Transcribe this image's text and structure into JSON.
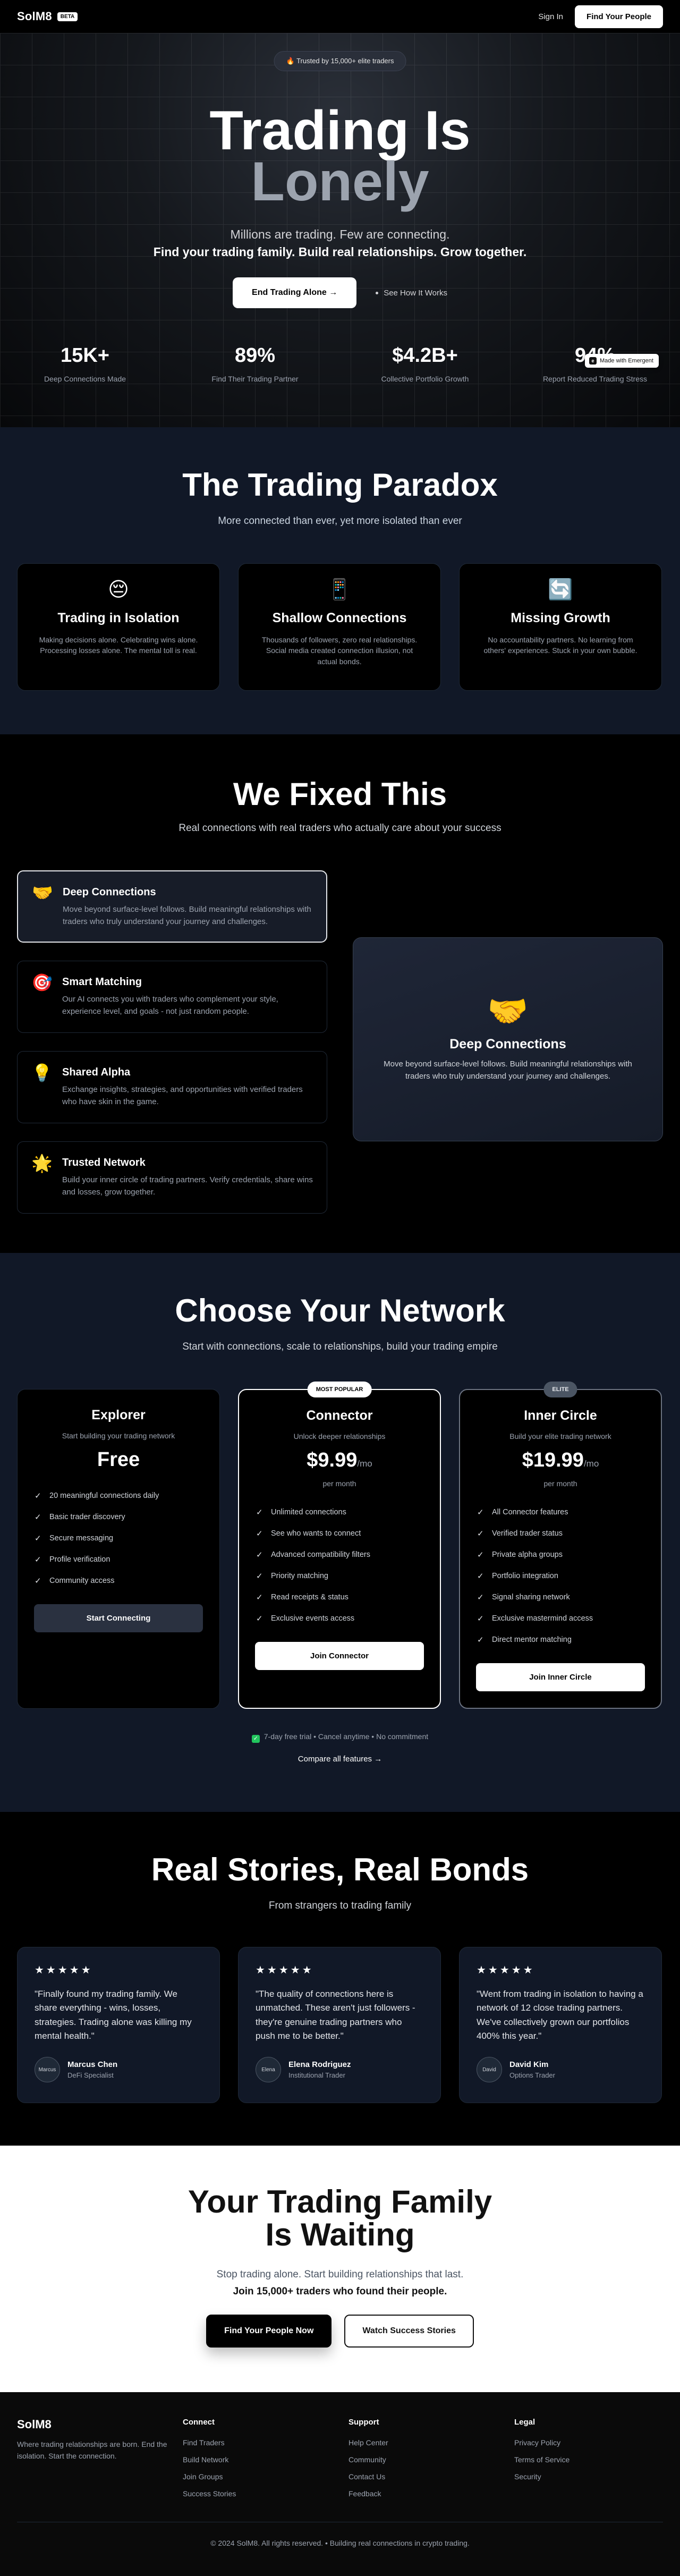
{
  "nav": {
    "brand": "SolM8",
    "badge": "BETA",
    "signin": "Sign In",
    "cta": "Find Your People"
  },
  "hero": {
    "trusted": "🔥 Trusted by 15,000+ elite traders",
    "title_line1": "Trading Is",
    "title_line2": "Lonely",
    "sub1": "Millions are trading. Few are connecting.",
    "sub2": "Find your trading family. Build real relationships. Grow together.",
    "cta": "End Trading Alone →",
    "secondary": "See How It Works",
    "stats": [
      {
        "value": "15K+",
        "label": "Deep Connections Made"
      },
      {
        "value": "89%",
        "label": "Find Their Trading Partner"
      },
      {
        "value": "$4.2B+",
        "label": "Collective Portfolio Growth"
      },
      {
        "value": "94%",
        "label": "Report Reduced Trading Stress"
      }
    ],
    "badge_emergent": "Made with Emergent"
  },
  "paradox": {
    "title": "The Trading Paradox",
    "subtitle": "More connected than ever, yet more isolated than ever",
    "cards": [
      {
        "emoji": "😔",
        "title": "Trading in Isolation",
        "text": "Making decisions alone. Celebrating wins alone. Processing losses alone. The mental toll is real."
      },
      {
        "emoji": "📱",
        "title": "Shallow Connections",
        "text": "Thousands of followers, zero real relationships. Social media created connection illusion, not actual bonds."
      },
      {
        "emoji": "🔄",
        "title": "Missing Growth",
        "text": "No accountability partners. No learning from others' experiences. Stuck in your own bubble."
      }
    ]
  },
  "fixed": {
    "title": "We Fixed This",
    "subtitle": "Real connections with real traders who actually care about your success",
    "items": [
      {
        "emoji": "🤝",
        "title": "Deep Connections",
        "text": "Move beyond surface-level follows. Build meaningful relationships with traders who truly understand your journey and challenges."
      },
      {
        "emoji": "🎯",
        "title": "Smart Matching",
        "text": "Our AI connects you with traders who complement your style, experience level, and goals - not just random people."
      },
      {
        "emoji": "💡",
        "title": "Shared Alpha",
        "text": "Exchange insights, strategies, and opportunities with verified traders who have skin in the game."
      },
      {
        "emoji": "🌟",
        "title": "Trusted Network",
        "text": "Build your inner circle of trading partners. Verify credentials, share wins and losses, grow together."
      }
    ],
    "panel": {
      "emoji": "🤝",
      "title": "Deep Connections",
      "text": "Move beyond surface-level follows. Build meaningful relationships with traders who truly understand your journey and challenges."
    }
  },
  "pricing": {
    "title": "Choose Your Network",
    "subtitle": "Start with connections, scale to relationships, build your trading empire",
    "plans": [
      {
        "name": "Explorer",
        "desc": "Start building your trading network",
        "price": "Free",
        "per": "",
        "period": "",
        "features": [
          "20 meaningful connections daily",
          "Basic trader discovery",
          "Secure messaging",
          "Profile verification",
          "Community access"
        ],
        "button": "Start Connecting"
      },
      {
        "badge": "MOST POPULAR",
        "name": "Connector",
        "desc": "Unlock deeper relationships",
        "price": "$9.99",
        "per": "/mo",
        "period": "per month",
        "features": [
          "Unlimited connections",
          "See who wants to connect",
          "Advanced compatibility filters",
          "Priority matching",
          "Read receipts & status",
          "Exclusive events access"
        ],
        "button": "Join Connector"
      },
      {
        "badge": "ELITE",
        "name": "Inner Circle",
        "desc": "Build your elite trading network",
        "price": "$19.99",
        "per": "/mo",
        "period": "per month",
        "features": [
          "All Connector features",
          "Verified trader status",
          "Private alpha groups",
          "Portfolio integration",
          "Signal sharing network",
          "Exclusive mastermind access",
          "Direct mentor matching"
        ],
        "button": "Join Inner Circle"
      }
    ],
    "trial": "7-day free trial • Cancel anytime • No commitment",
    "trial_icon": "✓",
    "compare": "Compare all features →"
  },
  "stories": {
    "title": "Real Stories, Real Bonds",
    "subtitle": "From strangers to trading family",
    "stars": "★★★★★",
    "items": [
      {
        "quote": "\"Finally found my trading family. We share everything - wins, losses, strategies. Trading alone was killing my mental health.\"",
        "avatar": "Marcus",
        "name": "Marcus Chen",
        "role": "DeFi Specialist"
      },
      {
        "quote": "\"The quality of connections here is unmatched. These aren't just followers - they're genuine trading partners who push me to be better.\"",
        "avatar": "Elena",
        "name": "Elena Rodriguez",
        "role": "Institutional Trader"
      },
      {
        "quote": "\"Went from trading in isolation to having a network of 12 close trading partners. We've collectively grown our portfolios 400% this year.\"",
        "avatar": "David",
        "name": "David Kim",
        "role": "Options Trader"
      }
    ]
  },
  "final": {
    "title_line1": "Your Trading Family",
    "title_line2": "Is Waiting",
    "sub1": "Stop trading alone. Start building relationships that last.",
    "sub2": "Join 15,000+ traders who found their people.",
    "cta_primary": "Find Your People Now",
    "cta_secondary": "Watch Success Stories"
  },
  "footer": {
    "brand": "SolM8",
    "tagline": "Where trading relationships are born. End the isolation. Start the connection.",
    "columns": [
      {
        "title": "Connect",
        "links": [
          "Find Traders",
          "Build Network",
          "Join Groups",
          "Success Stories"
        ]
      },
      {
        "title": "Support",
        "links": [
          "Help Center",
          "Community",
          "Contact Us",
          "Feedback"
        ]
      },
      {
        "title": "Legal",
        "links": [
          "Privacy Policy",
          "Terms of Service",
          "Security"
        ]
      }
    ],
    "copyright": "© 2024 SolM8. All rights reserved. • Building real connections in crypto trading."
  }
}
